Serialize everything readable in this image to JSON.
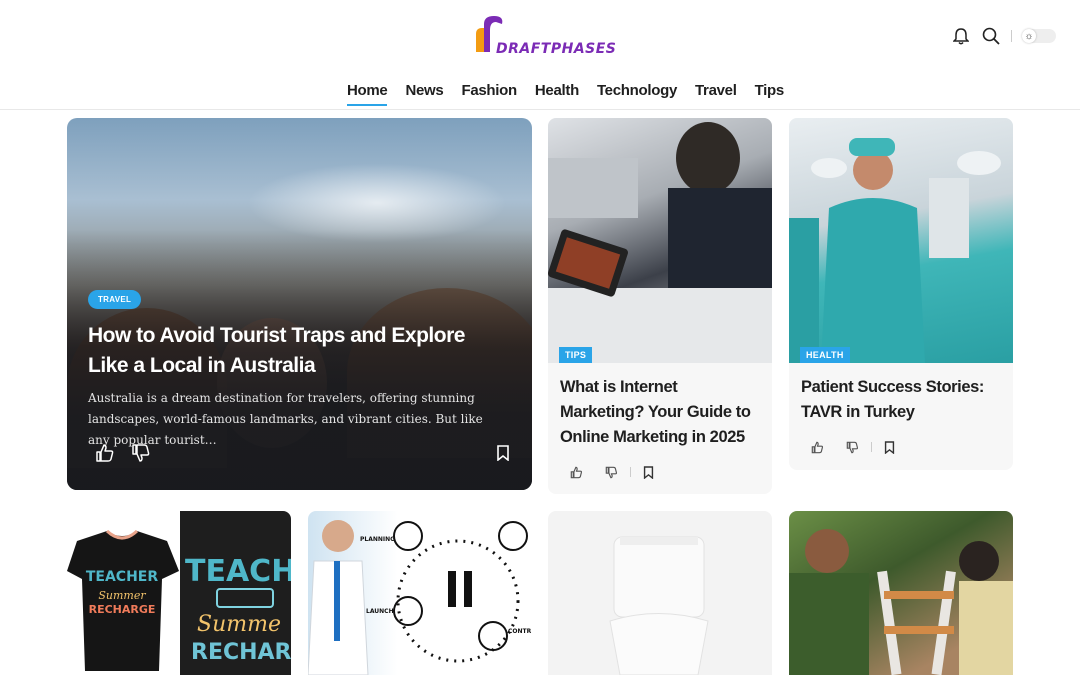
{
  "brand": {
    "logo_text": "DRAFTPHASES",
    "accent": "#2aa4e8",
    "logo_color": "#7b2bb5"
  },
  "nav": {
    "items": [
      {
        "label": "Home",
        "active": true
      },
      {
        "label": "News"
      },
      {
        "label": "Fashion"
      },
      {
        "label": "Health"
      },
      {
        "label": "Technology"
      },
      {
        "label": "Travel"
      },
      {
        "label": "Tips"
      }
    ]
  },
  "header_icons": [
    "bell-icon",
    "search-icon",
    "sun-icon"
  ],
  "hero": {
    "category": "TRAVEL",
    "title": "How to Avoid Tourist Traps and Explore Like a Local in Australia",
    "excerpt": "Australia is a dream destination for travelers, offering stunning landscapes, world-famous landmarks, and vibrant cities. But like any popular tourist…"
  },
  "cards": [
    {
      "category": "TIPS",
      "title": "What is Internet Marketing? Your Guide to Online Marketing in 2025"
    },
    {
      "category": "HEALTH",
      "title": "Patient Success Stories: TAVR in Turkey"
    }
  ],
  "bottom_cards": [
    {
      "image_text_1": "TEACHER",
      "image_text_2": "Summer",
      "image_text_3": "RECHARGE",
      "image_text_4": "TEACH",
      "image_text_5": "Summe",
      "image_text_6": "RECHAR"
    },
    {
      "label_1": "PLANNING",
      "label_2": "LAUNCH",
      "label_3": "CONTR"
    },
    {},
    {}
  ]
}
